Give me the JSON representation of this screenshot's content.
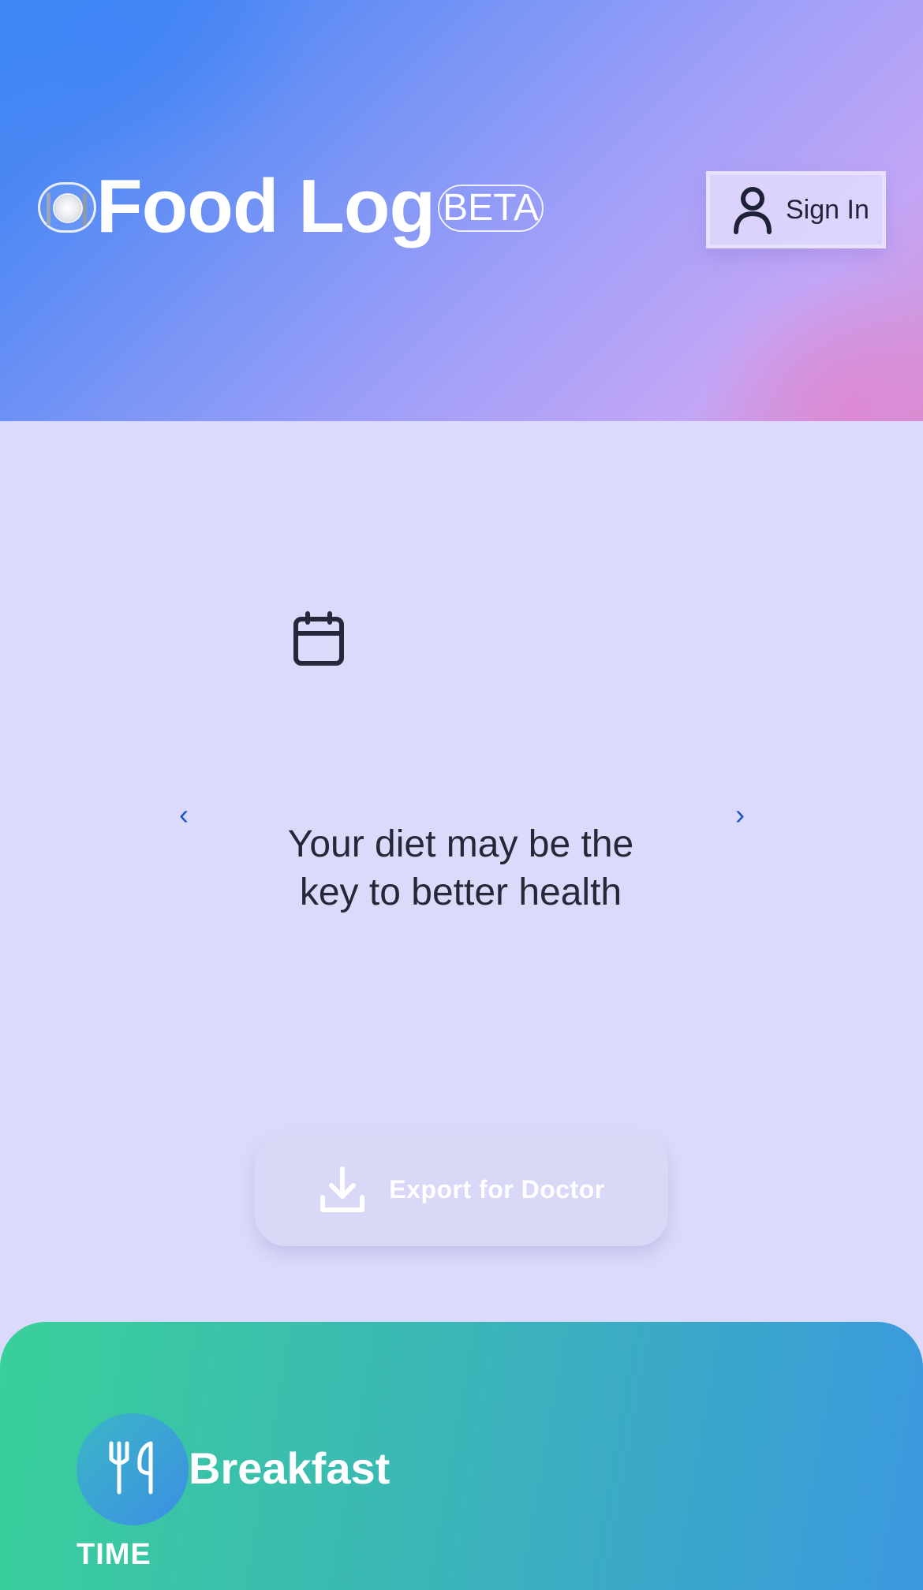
{
  "header": {
    "logo_icon": "plate-with-cutlery-icon",
    "title": "Food Log",
    "badge": "BETA",
    "sign_in_label": "Sign In",
    "sign_in_icon": "user-icon"
  },
  "carousel": {
    "icon": "calendar-icon",
    "prev_icon": "chevron-left-icon",
    "next_icon": "chevron-right-icon",
    "prev_glyph": "‹",
    "next_glyph": "›",
    "message": "Your diet may be the key to better health"
  },
  "export": {
    "label": "Export for Doctor",
    "icon": "download-icon"
  },
  "meal": {
    "icon": "fork-knife-icon",
    "title": "Breakfast",
    "time_label": "TIME"
  },
  "colors": {
    "header_gradient_start": "#3d88f4",
    "header_gradient_end": "#d88fd2",
    "page_background": "#dcdafa",
    "meal_card_gradient_start": "#39d09a",
    "meal_card_gradient_end": "#3b98df",
    "arrow_color": "#1a56c5"
  }
}
